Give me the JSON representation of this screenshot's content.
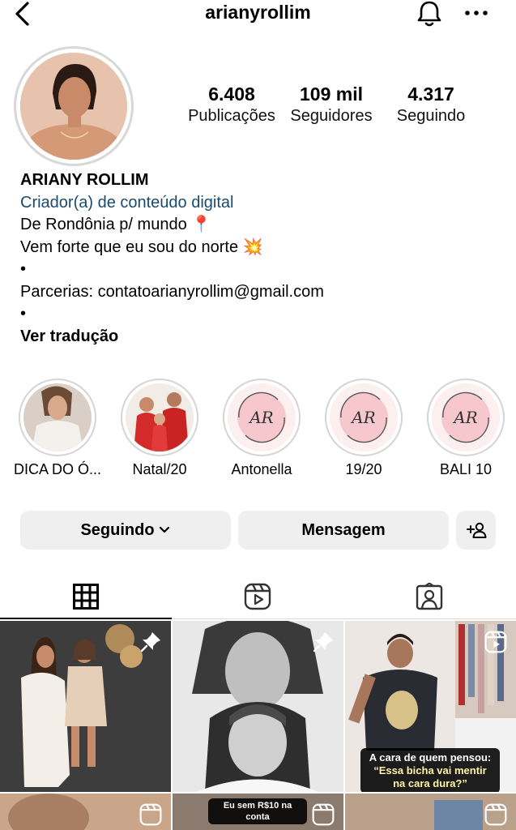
{
  "header": {
    "username": "arianyrollim"
  },
  "profile": {
    "stats": [
      {
        "value": "6.408",
        "label": "Publicações"
      },
      {
        "value": "109 mil",
        "label": "Seguidores"
      },
      {
        "value": "4.317",
        "label": "Seguindo"
      }
    ],
    "name": "ARIANY ROLLIM",
    "category": "Criador(a) de conteúdo digital",
    "bio_lines": [
      "De Rondônia p/ mundo 📍",
      "Vem forte que eu sou do norte 💥",
      "•",
      "Parcerias: contatoarianyrollim@gmail.com",
      "•"
    ],
    "translate_link": "Ver tradução"
  },
  "highlights": [
    {
      "label": "DICA DO Ó..."
    },
    {
      "label": "Natal/20"
    },
    {
      "label": "Antonella"
    },
    {
      "label": "19/20"
    },
    {
      "label": "BALI 10"
    }
  ],
  "highlight_logo_text": "AR",
  "actions": {
    "following_label": "Seguindo",
    "message_label": "Mensagem"
  },
  "tabs": [
    {
      "icon": "grid-icon"
    },
    {
      "icon": "reels-icon"
    },
    {
      "icon": "tagged-icon"
    }
  ],
  "posts": {
    "post3_caption_line1": "A cara de quem pensou:",
    "post3_caption_line2": "“Essa bicha vai mentir",
    "post3_caption_line3": "na cara dura?”",
    "post5_caption": "Eu sem R$10 na conta"
  },
  "colors": {
    "category_link": "#1c4a6e",
    "button_bg": "#efefef",
    "highlight_pink": "#f6c7cc"
  }
}
